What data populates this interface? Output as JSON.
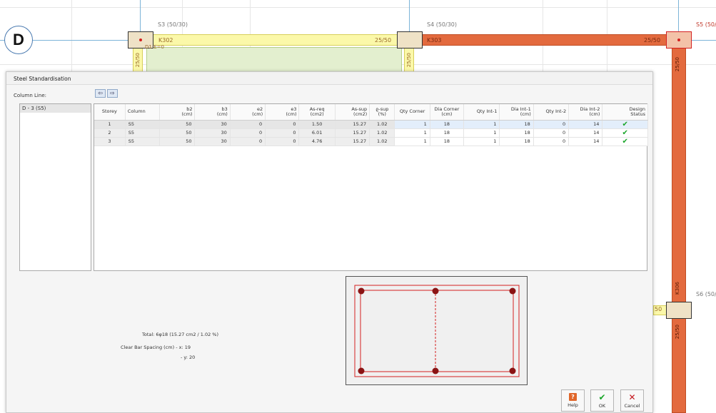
{
  "cad": {
    "axis_label": "D",
    "columns": [
      {
        "label": "S3 (50/30)"
      },
      {
        "label": "S4 (50/30)"
      },
      {
        "label": "S5 (50/"
      },
      {
        "label": "S6 (50/"
      }
    ],
    "beam_labels": [
      "K302",
      "25/50",
      "K303",
      "25/50",
      "25/50",
      "25/50",
      "K306",
      "25/50",
      "50",
      "25/50"
    ],
    "slab_label": "D1:E=0"
  },
  "dialog": {
    "title": "Steel Standardisation",
    "column_line_label": "Column Line:",
    "nav_prev_icon": "⇦",
    "nav_next_icon": "⇨",
    "column_lines": [
      "D - 3 (S5)"
    ],
    "table": {
      "headers": [
        [
          "Storey"
        ],
        [
          "Column"
        ],
        [
          "b2",
          "(cm)"
        ],
        [
          "b3",
          "(cm)"
        ],
        [
          "e2",
          "(cm)"
        ],
        [
          "e3",
          "(cm)"
        ],
        [
          "As-req",
          "(cm2)"
        ],
        [
          "As-sup",
          "(cm2)"
        ],
        [
          "ϱ-sup",
          "(%)"
        ],
        [
          "Qty Corner"
        ],
        [
          "Dia Corner",
          "(cm)"
        ],
        [
          "Qty Int-1"
        ],
        [
          "Dia Int-1",
          "(cm)"
        ],
        [
          "Qty Int-2"
        ],
        [
          "Dia Int-2",
          "(cm)"
        ],
        [
          "Design",
          "Status"
        ]
      ],
      "rows": [
        [
          "1",
          "S5",
          "50",
          "30",
          "0",
          "0",
          "1.50",
          "15.27",
          "1.02",
          "1",
          "18",
          "1",
          "18",
          "0",
          "14",
          "✔"
        ],
        [
          "2",
          "S5",
          "50",
          "30",
          "0",
          "0",
          "6.01",
          "15.27",
          "1.02",
          "1",
          "18",
          "1",
          "18",
          "0",
          "14",
          "✔"
        ],
        [
          "3",
          "S5",
          "50",
          "30",
          "0",
          "0",
          "4.76",
          "15.27",
          "1.02",
          "1",
          "18",
          "1",
          "18",
          "0",
          "14",
          "✔"
        ]
      ]
    },
    "summary": {
      "total": "Total: 6φ18  (15.27 cm2 / 1.02 %)",
      "spacing_x": "Clear Bar Spacing (cm) - x: 19",
      "spacing_y": "- y: 20"
    },
    "buttons": {
      "help": "Help",
      "ok": "OK",
      "cancel": "Cancel"
    },
    "colors": {
      "bar": "#8b1414",
      "section_outline": "#d42020",
      "check": "#1aa62a",
      "cancel": "#c4161c"
    }
  }
}
